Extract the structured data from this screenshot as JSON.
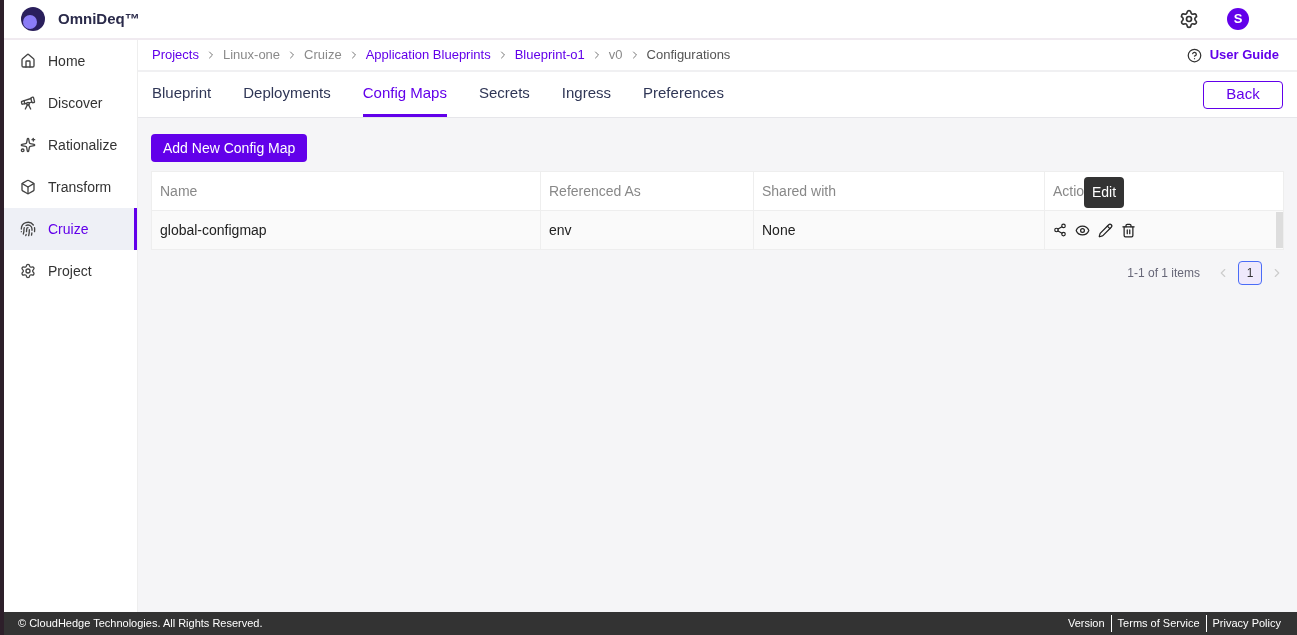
{
  "app": {
    "name": "OmniDeq™",
    "avatar": "S"
  },
  "sidebar": {
    "items": [
      {
        "label": "Home",
        "selected": false
      },
      {
        "label": "Discover",
        "selected": false
      },
      {
        "label": "Rationalize",
        "selected": false
      },
      {
        "label": "Transform",
        "selected": false
      },
      {
        "label": "Cruize",
        "selected": true
      },
      {
        "label": "Project",
        "selected": false
      }
    ]
  },
  "breadcrumbs": [
    {
      "label": "Projects",
      "kind": "link"
    },
    {
      "label": "Linux-one",
      "kind": "text"
    },
    {
      "label": "Cruize",
      "kind": "text"
    },
    {
      "label": "Application Blueprints",
      "kind": "link"
    },
    {
      "label": "Blueprint-o1",
      "kind": "link"
    },
    {
      "label": "v0",
      "kind": "text"
    },
    {
      "label": "Configurations",
      "kind": "current"
    }
  ],
  "user_guide": "User Guide",
  "tabs": [
    {
      "label": "Blueprint",
      "selected": false
    },
    {
      "label": "Deployments",
      "selected": false
    },
    {
      "label": "Config Maps",
      "selected": true
    },
    {
      "label": "Secrets",
      "selected": false
    },
    {
      "label": "Ingress",
      "selected": false
    },
    {
      "label": "Preferences",
      "selected": false
    }
  ],
  "back_button": "Back",
  "add_button": "Add New Config Map",
  "table": {
    "columns": [
      "Name",
      "Referenced As",
      "Shared with",
      "Actio"
    ],
    "rows": [
      {
        "cells": [
          "global-configmap",
          "env",
          "None"
        ]
      }
    ]
  },
  "tooltip": "Edit",
  "pagination": {
    "summary": "1-1 of 1 items",
    "pages": [
      {
        "label": "1",
        "selected": true
      }
    ]
  },
  "footer": {
    "copyright": "© CloudHedge Technologies. All Rights Reserved.",
    "links": [
      "Version",
      "Terms of Service",
      "Privacy Policy"
    ]
  }
}
